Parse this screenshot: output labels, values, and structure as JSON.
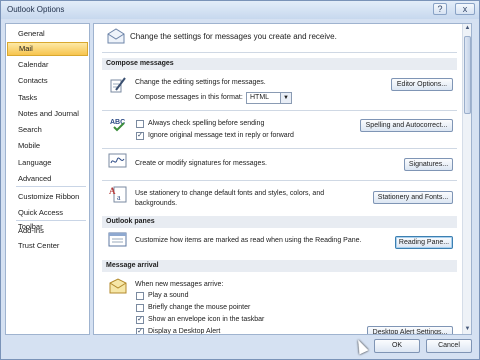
{
  "window": {
    "title": "Outlook Options",
    "help_icon": "?",
    "close_icon": "x"
  },
  "sidebar": {
    "items": [
      {
        "label": "General"
      },
      {
        "label": "Mail"
      },
      {
        "label": "Calendar"
      },
      {
        "label": "Contacts"
      },
      {
        "label": "Tasks"
      },
      {
        "label": "Notes and Journal"
      },
      {
        "label": "Search"
      },
      {
        "label": "Mobile"
      },
      {
        "label": "Language"
      },
      {
        "label": "Advanced"
      },
      {
        "label": "Customize Ribbon"
      },
      {
        "label": "Quick Access Toolbar"
      },
      {
        "label": "Add-Ins"
      },
      {
        "label": "Trust Center"
      }
    ],
    "selected": "Mail"
  },
  "main": {
    "intro": "Change the settings for messages you create and receive.",
    "compose": {
      "header": "Compose messages",
      "editing_text": "Change the editing settings for messages.",
      "editor_button": "Editor Options...",
      "format_label": "Compose messages in this format:",
      "format_value": "HTML",
      "check_spelling": "Always check spelling before sending",
      "check_spelling_checked": false,
      "ignore_original": "Ignore original message text in reply or forward",
      "ignore_original_checked": true,
      "spelling_button": "Spelling and Autocorrect...",
      "signatures_text": "Create or modify signatures for messages.",
      "signatures_button": "Signatures...",
      "stationery_text_1": "Use stationery to change default fonts and styles, colors, and",
      "stationery_text_2": "backgrounds.",
      "stationery_button": "Stationery and Fonts...",
      "abc_icon_text": "ABC"
    },
    "panes": {
      "header": "Outlook panes",
      "text": "Customize how items are marked as read when using the Reading Pane.",
      "button": "Reading Pane..."
    },
    "arrival": {
      "header": "Message arrival",
      "when_text": "When new messages arrive:",
      "options": [
        {
          "label": "Play a sound",
          "checked": false
        },
        {
          "label": "Briefly change the mouse pointer",
          "checked": false
        },
        {
          "label": "Show an envelope icon in the taskbar",
          "checked": true
        },
        {
          "label": "Display a Desktop Alert",
          "checked": true
        }
      ],
      "alert_button": "Desktop Alert Settings..."
    }
  },
  "footer": {
    "ok": "OK",
    "cancel": "Cancel"
  },
  "colors": {
    "selected_nav": "#f7c44e",
    "frame": "#d5e1f2",
    "section_header": "#e8ecf2"
  }
}
